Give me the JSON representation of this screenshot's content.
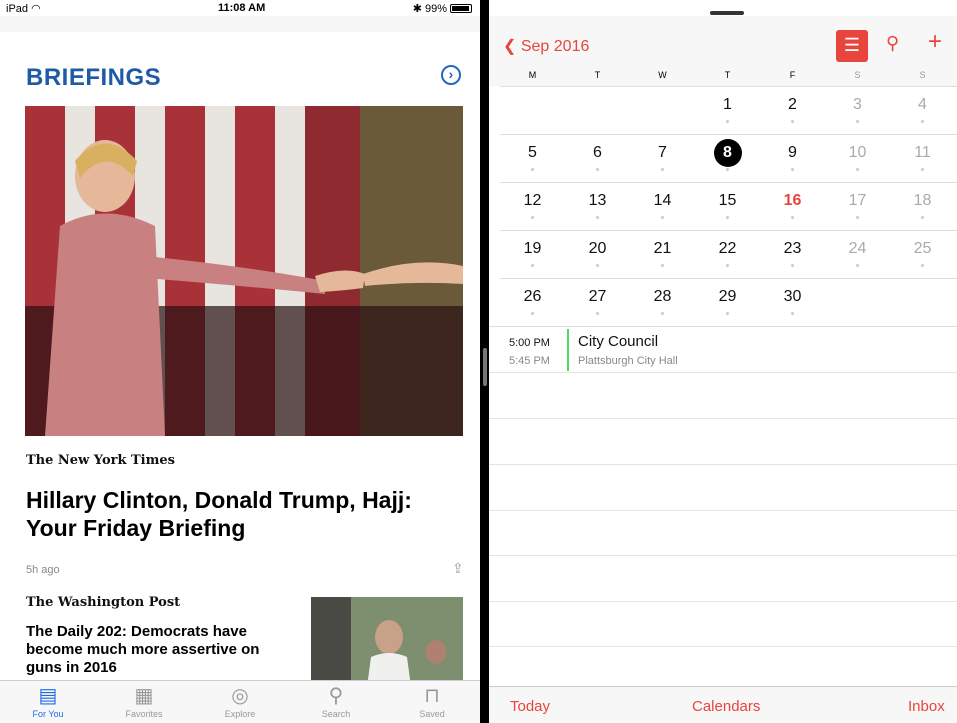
{
  "status": {
    "device": "iPad",
    "time": "11:08 AM",
    "battery": "99%"
  },
  "news": {
    "section_title": "BRIEFINGS",
    "story1": {
      "source": "The New York Times",
      "headline": "Hillary Clinton, Donald Trump, Hajj: Your Friday Briefing",
      "age": "5h ago"
    },
    "story2": {
      "source": "The Washington Post",
      "headline": "The Daily 202: Democrats have become much more assertive on guns in 2016"
    },
    "tabs": [
      {
        "label": "For You",
        "icon": "for-you-icon"
      },
      {
        "label": "Favorites",
        "icon": "favorites-grid-icon"
      },
      {
        "label": "Explore",
        "icon": "compass-icon"
      },
      {
        "label": "Search",
        "icon": "search-icon"
      },
      {
        "label": "Saved",
        "icon": "bookmark-icon"
      }
    ],
    "accent": "#1e6ce5"
  },
  "calendar": {
    "back_label": "Sep 2016",
    "days_of_week": [
      "M",
      "T",
      "W",
      "T",
      "F",
      "S",
      "S"
    ],
    "weeks": [
      [
        "",
        "",
        "",
        "1",
        "2",
        "3",
        "4"
      ],
      [
        "5",
        "6",
        "7",
        "8",
        "9",
        "10",
        "11"
      ],
      [
        "12",
        "13",
        "14",
        "15",
        "16",
        "17",
        "18"
      ],
      [
        "19",
        "20",
        "21",
        "22",
        "23",
        "24",
        "25"
      ],
      [
        "26",
        "27",
        "28",
        "29",
        "30",
        "",
        ""
      ]
    ],
    "today": "8",
    "highlighted": "16",
    "event": {
      "start": "5:00 PM",
      "end": "5:45 PM",
      "title": "City Council",
      "location": "Plattsburgh City Hall",
      "color": "#4cd964"
    },
    "bottom": {
      "today": "Today",
      "calendars": "Calendars",
      "inbox": "Inbox"
    },
    "accent": "#e8453c"
  }
}
